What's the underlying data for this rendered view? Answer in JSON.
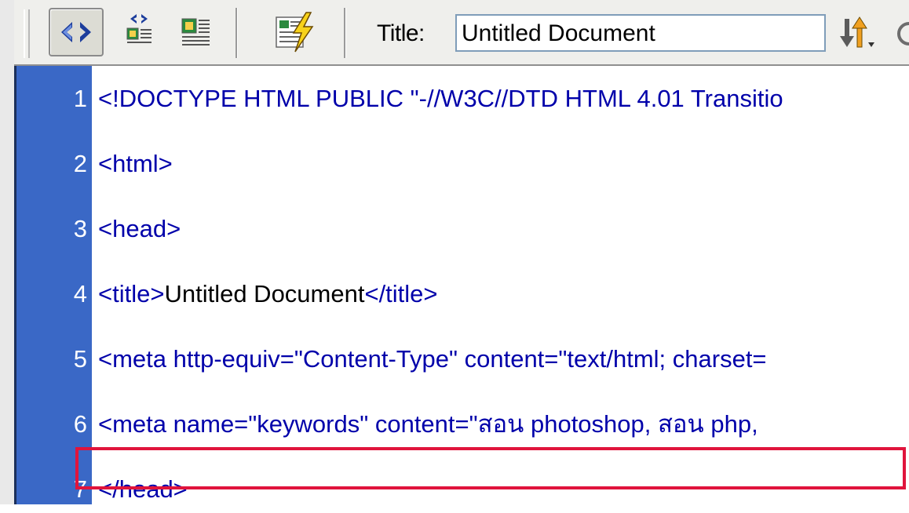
{
  "toolbar": {
    "buttons": [
      {
        "name": "code-view-icon"
      },
      {
        "name": "split-view-icon"
      },
      {
        "name": "design-view-icon"
      },
      {
        "name": "live-data-icon"
      },
      {
        "name": "file-management-icon"
      }
    ],
    "title_label": "Title:",
    "title_value": "Untitled Document"
  },
  "editor": {
    "lines": [
      {
        "num": "1",
        "code": "<!DOCTYPE HTML PUBLIC \"-//W3C//DTD HTML 4.01 Transitio"
      },
      {
        "num": "2",
        "code": "<html>"
      },
      {
        "num": "3",
        "code": "<head>"
      },
      {
        "num": "4",
        "tag_open": "<title>",
        "text": "Untitled Document",
        "tag_close": "</title>"
      },
      {
        "num": "5",
        "code": "<meta http-equiv=\"Content-Type\" content=\"text/html; charset="
      },
      {
        "num": "6",
        "code": "<meta name=\"keywords\" content=\"สอน photoshop, สอน php,"
      },
      {
        "num": "7",
        "code": "</head>"
      }
    ]
  },
  "colors": {
    "gutter": "#3a68c6",
    "highlight": "#e0143c",
    "tag": "#0000aa"
  }
}
